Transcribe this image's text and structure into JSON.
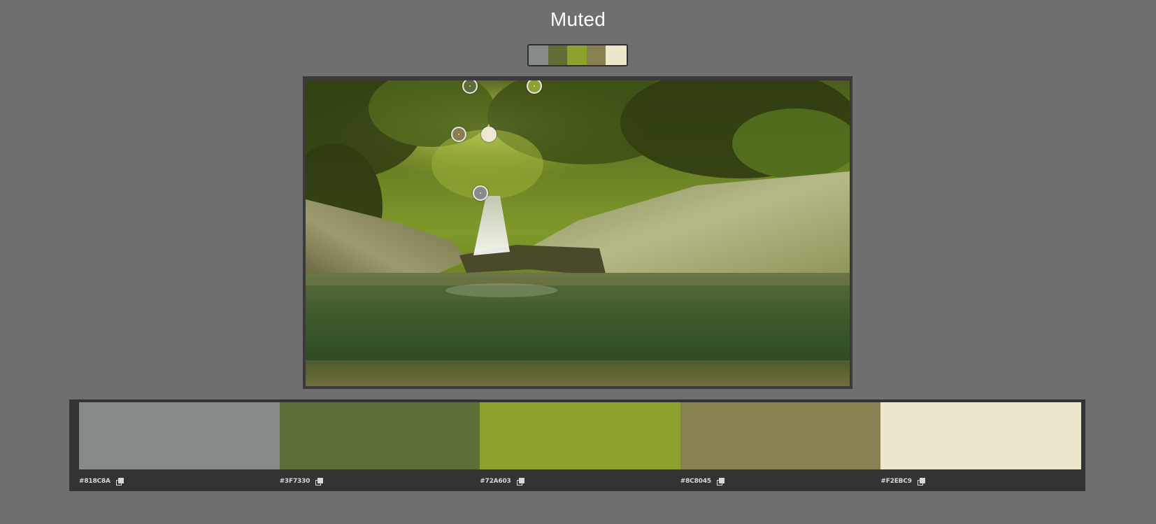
{
  "title": "Muted",
  "palette": [
    {
      "hex_label": "#818C8A",
      "color": "#858a8a"
    },
    {
      "hex_label": "#3F7330",
      "color": "#5d6e38"
    },
    {
      "hex_label": "#72A603",
      "color": "#8da22e"
    },
    {
      "hex_label": "#8C8045",
      "color": "#878050"
    },
    {
      "hex_label": "#F2EBC9",
      "color": "#ede8cb"
    }
  ],
  "markers": [
    {
      "name": "marker-1",
      "color": "#858a8a"
    },
    {
      "name": "marker-2",
      "color": "#5d6e38"
    },
    {
      "name": "marker-3",
      "color": "#8da22e"
    },
    {
      "name": "marker-4",
      "color": "#878050"
    },
    {
      "name": "marker-5",
      "color": "#ede8cb"
    }
  ],
  "image_subject": "waterfall-photo",
  "icons": {
    "copy": "copy-icon"
  }
}
